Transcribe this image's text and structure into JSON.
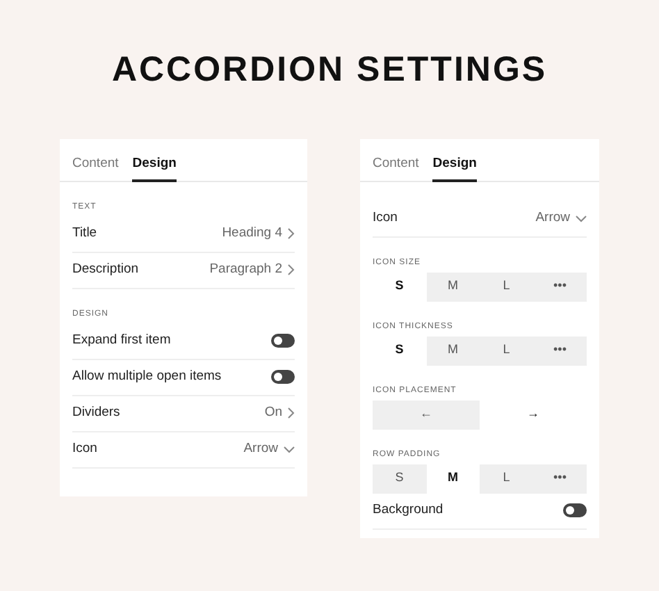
{
  "heading": "ACCORDION SETTINGS",
  "panels": [
    {
      "tabs": [
        {
          "label": "Content",
          "selected": false
        },
        {
          "label": "Design",
          "selected": true
        }
      ],
      "sections": [
        {
          "title": "TEXT",
          "items": [
            {
              "kind": "select",
              "label": "Title",
              "value": "Heading 4",
              "dropdown": false
            },
            {
              "kind": "select",
              "label": "Description",
              "value": "Paragraph 2",
              "dropdown": false
            }
          ]
        },
        {
          "title": "DESIGN",
          "items": [
            {
              "kind": "toggle",
              "label": "Expand first item",
              "on": false
            },
            {
              "kind": "toggle",
              "label": "Allow multiple open items",
              "on": false
            },
            {
              "kind": "select",
              "label": "Dividers",
              "value": "On",
              "dropdown": false
            },
            {
              "kind": "select",
              "label": "Icon",
              "value": "Arrow",
              "dropdown": true
            }
          ]
        }
      ]
    },
    {
      "tabs": [
        {
          "label": "Content",
          "selected": false
        },
        {
          "label": "Design",
          "selected": true
        }
      ],
      "sections": [
        {
          "items": [
            {
              "kind": "select",
              "label": "Icon",
              "value": "Arrow",
              "dropdown": true
            }
          ]
        },
        {
          "title": "ICON SIZE",
          "items": [
            {
              "kind": "segmented",
              "options": [
                {
                  "label": "S",
                  "selected": true
                },
                {
                  "label": "M",
                  "selected": false
                },
                {
                  "label": "L",
                  "selected": false
                },
                {
                  "label": "•••",
                  "selected": false
                }
              ]
            }
          ]
        },
        {
          "title": "ICON THICKNESS",
          "items": [
            {
              "kind": "segmented",
              "options": [
                {
                  "label": "S",
                  "selected": true
                },
                {
                  "label": "M",
                  "selected": false
                },
                {
                  "label": "L",
                  "selected": false
                },
                {
                  "label": "•••",
                  "selected": false
                }
              ]
            }
          ]
        },
        {
          "title": "ICON PLACEMENT",
          "items": [
            {
              "kind": "segmented",
              "options": [
                {
                  "label": "←",
                  "selected": false
                },
                {
                  "label": "→",
                  "selected": true
                }
              ]
            }
          ]
        },
        {
          "title": "ROW PADDING",
          "items": [
            {
              "kind": "segmented",
              "options": [
                {
                  "label": "S",
                  "selected": false
                },
                {
                  "label": "M",
                  "selected": true
                },
                {
                  "label": "L",
                  "selected": false
                },
                {
                  "label": "•••",
                  "selected": false
                }
              ]
            },
            {
              "kind": "toggle",
              "label": "Background",
              "on": false
            }
          ]
        }
      ]
    }
  ]
}
